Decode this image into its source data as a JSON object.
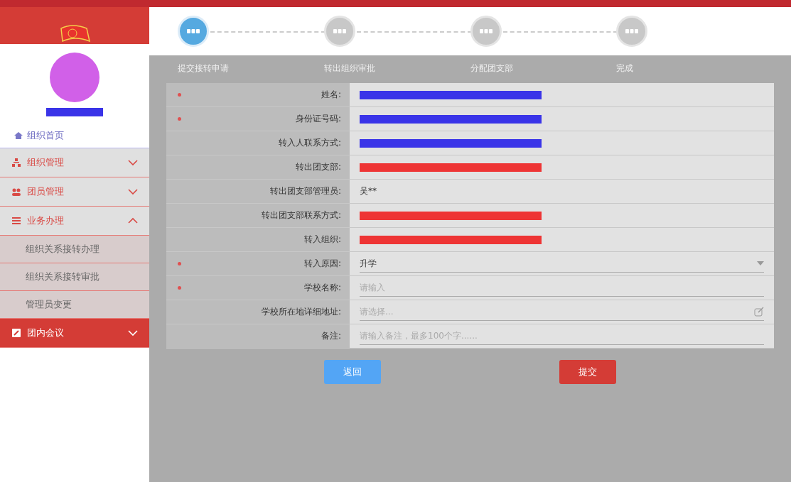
{
  "sidebar": {
    "home": "组织首页",
    "menu": [
      {
        "label": "组织管理",
        "kind": "group",
        "expanded": false,
        "selected": false
      },
      {
        "label": "团员管理",
        "kind": "group",
        "expanded": false,
        "selected": false
      },
      {
        "label": "业务办理",
        "kind": "group",
        "expanded": true,
        "selected": false,
        "children": [
          {
            "label": "组织关系接转办理"
          },
          {
            "label": "组织关系接转审批"
          },
          {
            "label": "管理员变更"
          }
        ]
      },
      {
        "label": "团内会议",
        "kind": "group",
        "expanded": false,
        "selected": true
      }
    ]
  },
  "steps": [
    {
      "label": "提交接转申请",
      "selected": true
    },
    {
      "label": "转出组织审批",
      "selected": false
    },
    {
      "label": "分配团支部",
      "selected": false
    },
    {
      "label": "完成",
      "selected": false
    }
  ],
  "form": {
    "rows": [
      {
        "label": "姓名:",
        "kind": "redacted",
        "required": true,
        "color": "#3a34e8"
      },
      {
        "label": "身份证号码:",
        "kind": "redacted",
        "required": true,
        "color": "#3a34e8"
      },
      {
        "label": "转入人联系方式:",
        "kind": "redacted",
        "required": false,
        "color": "#3a34e8"
      },
      {
        "label": "转出团支部:",
        "kind": "redacted",
        "required": false,
        "color": "#ee3434"
      },
      {
        "label": "转出团支部管理员:",
        "kind": "text",
        "required": false,
        "value": "吴**"
      },
      {
        "label": "转出团支部联系方式:",
        "kind": "redacted",
        "required": false,
        "color": "#ee3434"
      },
      {
        "label": "转入组织:",
        "kind": "redacted",
        "required": false,
        "color": "#ee3434"
      },
      {
        "label": "转入原因:",
        "kind": "select",
        "required": true,
        "value": "升学"
      },
      {
        "label": "学校名称:",
        "kind": "input",
        "required": true,
        "placeholder": "请输入"
      },
      {
        "label": "学校所在地详细地址:",
        "kind": "picker",
        "required": false,
        "placeholder": "请选择..."
      },
      {
        "label": "备注:",
        "kind": "input",
        "required": false,
        "placeholder": "请输入备注，最多100个字......"
      }
    ]
  },
  "buttons": [
    {
      "label": "返回",
      "kind": "back"
    },
    {
      "label": "提交",
      "kind": "submit"
    }
  ]
}
